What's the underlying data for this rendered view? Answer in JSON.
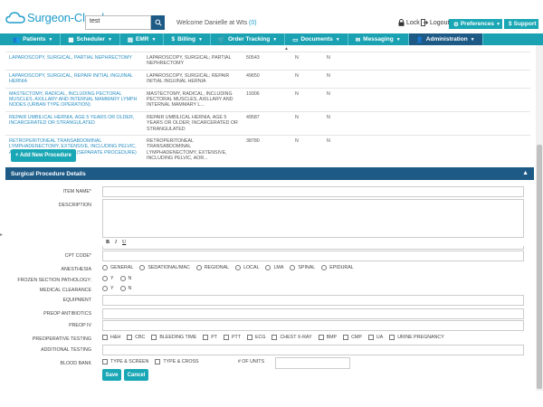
{
  "header": {
    "logo_text": "Surgeon-Cloud",
    "search_value": "test",
    "welcome": "Welcome Danielle at Wts",
    "welcome_count": "(0)",
    "lock": "Lock",
    "logout": "Logout",
    "preferences": "Preferences",
    "support": "Support"
  },
  "nav": {
    "items": [
      {
        "label": "Patients"
      },
      {
        "label": "Scheduler"
      },
      {
        "label": "EMR"
      },
      {
        "label": "Billing"
      },
      {
        "label": "Order Tracking"
      },
      {
        "label": "Documents"
      },
      {
        "label": "Messaging"
      },
      {
        "label": "Administration"
      }
    ]
  },
  "procedures": {
    "rows": [
      {
        "name": "LAPAROSCOPY, SURGICAL, PARTIAL NEPHRECTOMY",
        "desc": "LAPAROSCOPY, SURGICAL; PARTIAL NEPHRECTOMY",
        "cpt": "50543",
        "f1": "N",
        "f2": "N"
      },
      {
        "name": "LAPAROSCOPY, SURGICAL, REPAIR INITIAL INGUINAL HERNIA",
        "desc": "LAPAROSCOPY, SURGICAL; REPAIR INITIAL INGUINAL HERNIA",
        "cpt": "49650",
        "f1": "N",
        "f2": "N"
      },
      {
        "name": "MASTECTOMY, RADICAL, INCLUDING PECTORAL MUSCLES, AXILLARY AND INTERNAL MAMMARY LYMPH NODES (URBAN TYPE OPERATION)",
        "desc": "MASTECTOMY, RADICAL, INCLUDING PECTORAL MUSCLES, AXILLARY AND INTERNAL MAMMARY L...",
        "cpt": "19306",
        "f1": "N",
        "f2": "N"
      },
      {
        "name": "REPAIR UMBILICAL HERNIA, AGE 5 YEARS OR OLDER, INCARCERATED OR STRANGULATED",
        "desc": "REPAIR UMBILICAL HERNIA, AGE 5 YEARS OR OLDER; INCARCERATED OR STRANGULATED",
        "cpt": "49587",
        "f1": "N",
        "f2": "N"
      },
      {
        "name": "RETROPERITONEAL TRANSABDOMINAL LYMPHADENECTOMY, EXTENSIVE, INCLUDING PELVIC, AORTIC, AND RENAL NODES (SEPARATE PROCEDURE)",
        "desc": "RETROPERITONEAL TRANSABDOMINAL LYMPHADENECTOMY, EXTENSIVE, INCLUDING PELVIC, AOR...",
        "cpt": "38780",
        "f1": "N",
        "f2": "N"
      }
    ]
  },
  "add_button": "+ Add New Procedure",
  "details": {
    "title": "Surgical Procedure Details",
    "item_name_label": "ITEM NAME*",
    "description_label": "DESCRIPTION",
    "rte_bold": "B",
    "rte_italic": "I",
    "rte_underline": "U",
    "cpt_label": "CPT CODE*",
    "anesthesia_label": "ANESTHESIA",
    "anesthesia_options": [
      "GENERAL",
      "SEDATIONAL/MAC",
      "REGIONAL",
      "LOCAL",
      "LMA",
      "SPINAL",
      "EPIDURAL"
    ],
    "frozen_label": "FROZEN SECTION PATHOLOGY:",
    "medical_label": "MEDICAL CLEARANCE",
    "yes": "Y",
    "no": "N",
    "equipment_label": "EQUIPMENT",
    "antibiotics_label": "PREOP ANTIBIOTICS",
    "iv_label": "PREOP IV",
    "testing_label": "PREOPERATIVE TESTING",
    "testing_options": [
      "H&H",
      "CBC",
      "BLEEDING TIME",
      "PT",
      "PTT",
      "ECG",
      "CHEST X-RAY",
      "BMP",
      "CMP",
      "UA",
      "URINE PREGNANCY"
    ],
    "additional_label": "ADDITIONAL TESTING",
    "blood_label": "BLOOD BANK",
    "blood_options": [
      "TYPE & SCREEN",
      "TYPE & CROSS"
    ],
    "units_label": "# OF UNITS",
    "save": "Save",
    "cancel": "Cancel"
  },
  "colors": {
    "teal": "#1aa7b5",
    "navy": "#1d5a86",
    "link": "#2a8fc4"
  }
}
